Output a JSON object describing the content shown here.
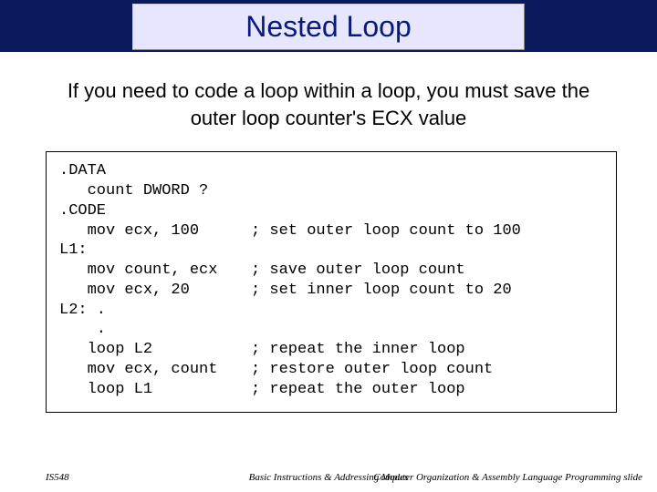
{
  "title": "Nested Loop",
  "body": "If you need to code a loop within a loop, you must save the outer loop counter's ECX value",
  "code": {
    "l0": ".DATA",
    "l1": "   count DWORD ?",
    "l2": ".CODE",
    "l3a": "   mov ecx, 100",
    "l3c": "; set outer loop count to 100",
    "l4": "L1:",
    "l5a": "   mov count, ecx",
    "l5c": "; save outer loop count",
    "l6a": "   mov ecx, 20",
    "l6c": "; set inner loop count to 20",
    "l7": "L2: .",
    "l8": "    .",
    "l9a": "   loop L2",
    "l9c": "; repeat the inner loop",
    "l10a": "   mov ecx, count",
    "l10c": "; restore outer loop count",
    "l11a": "   loop L1",
    "l11c": "; repeat the outer loop"
  },
  "footer": {
    "left": "IS548",
    "mid": "Basic Instructions & Addressing Modes",
    "right": "Computer Organization & Assembly Language Programming slide"
  }
}
